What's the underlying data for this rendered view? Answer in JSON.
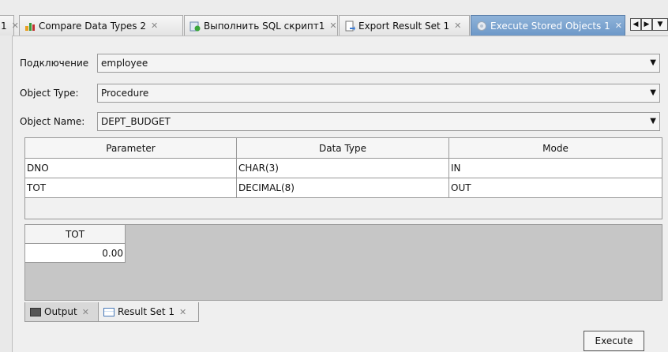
{
  "tabs": [
    {
      "label": "1",
      "partial": true
    },
    {
      "label": "Compare Data Types 2"
    },
    {
      "label": "Выполнить SQL скрипт1"
    },
    {
      "label": "Export Result Set 1"
    },
    {
      "label": "Execute Stored Objects 1",
      "active": true
    }
  ],
  "form": {
    "connection_label": "Подключение",
    "connection_value": "employee",
    "object_type_label": "Object Type:",
    "object_type_value": "Procedure",
    "object_name_label": "Object Name:",
    "object_name_value": "DEPT_BUDGET"
  },
  "params_table": {
    "headers": [
      "Parameter",
      "Data Type",
      "Mode"
    ],
    "rows": [
      [
        "DNO",
        "CHAR(3)",
        "IN"
      ],
      [
        "TOT",
        "DECIMAL(8)",
        "OUT"
      ]
    ]
  },
  "result": {
    "column": "TOT",
    "value": "0.00"
  },
  "bottom_tabs": [
    {
      "label": "Output",
      "icon": "output-icon"
    },
    {
      "label": "Result Set 1",
      "icon": "grid-icon"
    }
  ],
  "execute_label": "Execute",
  "colors": {
    "active_tab": "#6d98c8",
    "result_bg": "#c6c6c6"
  }
}
